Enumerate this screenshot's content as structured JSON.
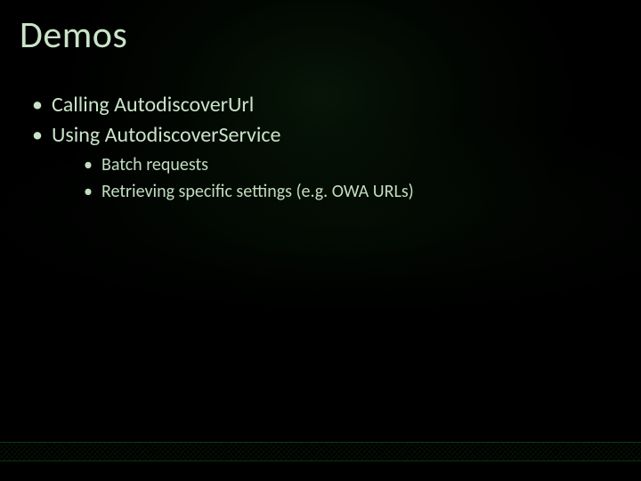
{
  "title": "Demos",
  "bullets": [
    {
      "text": "Calling AutodiscoverUrl",
      "children": []
    },
    {
      "text": "Using AutodiscoverService",
      "children": [
        {
          "text": "Batch requests"
        },
        {
          "text": "Retrieving specific settings (e.g. OWA URLs)"
        }
      ]
    }
  ]
}
